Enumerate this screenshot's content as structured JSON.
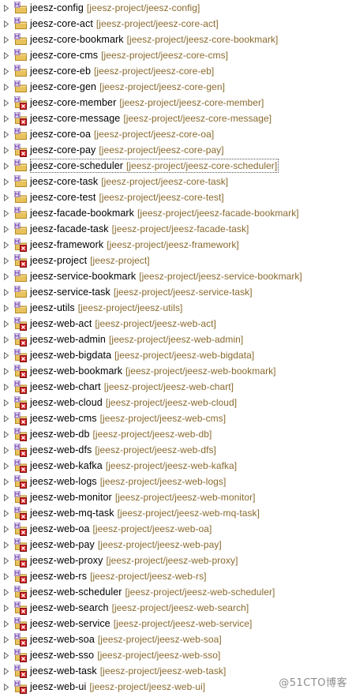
{
  "tree": {
    "items": [
      {
        "name": "jeesz-config",
        "path": "[jeesz-project/jeesz-config]",
        "overlay": "none"
      },
      {
        "name": "jeesz-core-act",
        "path": "[jeesz-project/jeesz-core-act]",
        "overlay": "none"
      },
      {
        "name": "jeesz-core-bookmark",
        "path": "[jeesz-project/jeesz-core-bookmark]",
        "overlay": "none"
      },
      {
        "name": "jeesz-core-cms",
        "path": "[jeesz-project/jeesz-core-cms]",
        "overlay": "none"
      },
      {
        "name": "jeesz-core-eb",
        "path": "[jeesz-project/jeesz-core-eb]",
        "overlay": "none"
      },
      {
        "name": "jeesz-core-gen",
        "path": "[jeesz-project/jeesz-core-gen]",
        "overlay": "none"
      },
      {
        "name": "jeesz-core-member",
        "path": "[jeesz-project/jeesz-core-member]",
        "overlay": "error"
      },
      {
        "name": "jeesz-core-message",
        "path": "[jeesz-project/jeesz-core-message]",
        "overlay": "error"
      },
      {
        "name": "jeesz-core-oa",
        "path": "[jeesz-project/jeesz-core-oa]",
        "overlay": "none"
      },
      {
        "name": "jeesz-core-pay",
        "path": "[jeesz-project/jeesz-core-pay]",
        "overlay": "error"
      },
      {
        "name": "jeesz-core-scheduler",
        "path": "[jeesz-project/jeesz-core-scheduler]",
        "overlay": "none",
        "selected": true
      },
      {
        "name": "jeesz-core-task",
        "path": "[jeesz-project/jeesz-core-task]",
        "overlay": "none"
      },
      {
        "name": "jeesz-core-test",
        "path": "[jeesz-project/jeesz-core-test]",
        "overlay": "none"
      },
      {
        "name": "jeesz-facade-bookmark",
        "path": "[jeesz-project/jeesz-facade-bookmark]",
        "overlay": "none"
      },
      {
        "name": "jeesz-facade-task",
        "path": "[jeesz-project/jeesz-facade-task]",
        "overlay": "none"
      },
      {
        "name": "jeesz-framework",
        "path": "[jeesz-project/jeesz-framework]",
        "overlay": "error"
      },
      {
        "name": "jeesz-project",
        "path": "[jeesz-project]",
        "overlay": "error"
      },
      {
        "name": "jeesz-service-bookmark",
        "path": "[jeesz-project/jeesz-service-bookmark]",
        "overlay": "none"
      },
      {
        "name": "jeesz-service-task",
        "path": "[jeesz-project/jeesz-service-task]",
        "overlay": "none"
      },
      {
        "name": "jeesz-utils",
        "path": "[jeesz-project/jeesz-utils]",
        "overlay": "none"
      },
      {
        "name": "jeesz-web-act",
        "path": "[jeesz-project/jeesz-web-act]",
        "overlay": "error"
      },
      {
        "name": "jeesz-web-admin",
        "path": "[jeesz-project/jeesz-web-admin]",
        "overlay": "error"
      },
      {
        "name": "jeesz-web-bigdata",
        "path": "[jeesz-project/jeesz-web-bigdata]",
        "overlay": "error"
      },
      {
        "name": "jeesz-web-bookmark",
        "path": "[jeesz-project/jeesz-web-bookmark]",
        "overlay": "error"
      },
      {
        "name": "jeesz-web-chart",
        "path": "[jeesz-project/jeesz-web-chart]",
        "overlay": "error"
      },
      {
        "name": "jeesz-web-cloud",
        "path": "[jeesz-project/jeesz-web-cloud]",
        "overlay": "error"
      },
      {
        "name": "jeesz-web-cms",
        "path": "[jeesz-project/jeesz-web-cms]",
        "overlay": "error"
      },
      {
        "name": "jeesz-web-db",
        "path": "[jeesz-project/jeesz-web-db]",
        "overlay": "error"
      },
      {
        "name": "jeesz-web-dfs",
        "path": "[jeesz-project/jeesz-web-dfs]",
        "overlay": "error"
      },
      {
        "name": "jeesz-web-kafka",
        "path": "[jeesz-project/jeesz-web-kafka]",
        "overlay": "error"
      },
      {
        "name": "jeesz-web-logs",
        "path": "[jeesz-project/jeesz-web-logs]",
        "overlay": "error"
      },
      {
        "name": "jeesz-web-monitor",
        "path": "[jeesz-project/jeesz-web-monitor]",
        "overlay": "error"
      },
      {
        "name": "jeesz-web-mq-task",
        "path": "[jeesz-project/jeesz-web-mq-task]",
        "overlay": "error"
      },
      {
        "name": "jeesz-web-oa",
        "path": "[jeesz-project/jeesz-web-oa]",
        "overlay": "error"
      },
      {
        "name": "jeesz-web-pay",
        "path": "[jeesz-project/jeesz-web-pay]",
        "overlay": "error"
      },
      {
        "name": "jeesz-web-proxy",
        "path": "[jeesz-project/jeesz-web-proxy]",
        "overlay": "error"
      },
      {
        "name": "jeesz-web-rs",
        "path": "[jeesz-project/jeesz-web-rs]",
        "overlay": "error"
      },
      {
        "name": "jeesz-web-scheduler",
        "path": "[jeesz-project/jeesz-web-scheduler]",
        "overlay": "error"
      },
      {
        "name": "jeesz-web-search",
        "path": "[jeesz-project/jeesz-web-search]",
        "overlay": "error"
      },
      {
        "name": "jeesz-web-service",
        "path": "[jeesz-project/jeesz-web-service]",
        "overlay": "error"
      },
      {
        "name": "jeesz-web-soa",
        "path": "[jeesz-project/jeesz-web-soa]",
        "overlay": "error"
      },
      {
        "name": "jeesz-web-sso",
        "path": "[jeesz-project/jeesz-web-sso]",
        "overlay": "error"
      },
      {
        "name": "jeesz-web-task",
        "path": "[jeesz-project/jeesz-web-task]",
        "overlay": "error"
      },
      {
        "name": "jeesz-web-ui",
        "path": "[jeesz-project/jeesz-web-ui]",
        "overlay": "error"
      }
    ]
  },
  "watermark": {
    "text": "@51CTO博客"
  },
  "colors": {
    "name": "#000000",
    "path": "#8a6a2e",
    "folder_fill": "#e8c25c",
    "folder_edge": "#b58a22",
    "m_badge": "#7b4fb3",
    "error_badge": "#d32121",
    "arrow": "#6e6e6e",
    "watermark": "#8d8d8d"
  },
  "icons": {
    "expander": "chevron-right-icon",
    "project": "maven-project-folder-icon",
    "error_overlay": "error-overlay-icon"
  }
}
